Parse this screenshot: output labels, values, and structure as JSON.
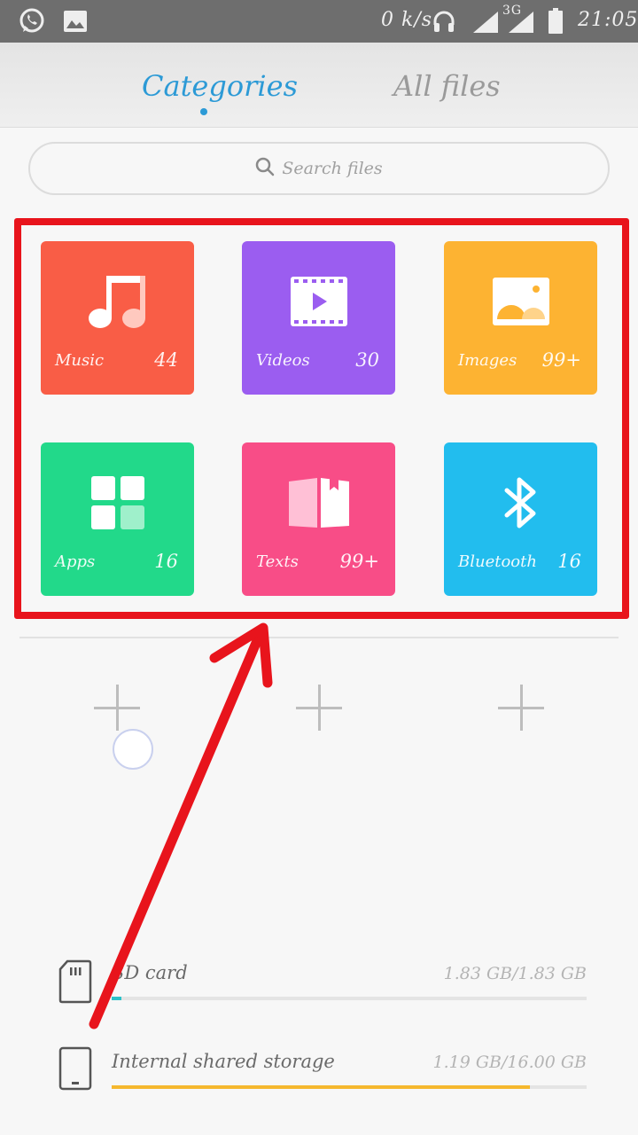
{
  "status_bar": {
    "speed": "0 k/s",
    "network": "3G",
    "time": "21:05",
    "icons": [
      "whatsapp-icon",
      "gallery-icon",
      "headphones-icon",
      "signal-icon",
      "battery-icon"
    ]
  },
  "tabs": [
    {
      "label": "Categories",
      "active": true
    },
    {
      "label": "All files",
      "active": false
    }
  ],
  "search": {
    "placeholder": "Search files"
  },
  "categories": [
    {
      "label": "Music",
      "count": "44",
      "color": "#f95d46",
      "icon": "music-note-icon"
    },
    {
      "label": "Videos",
      "count": "30",
      "color": "#9b5df0",
      "icon": "video-icon"
    },
    {
      "label": "Images",
      "count": "99+",
      "color": "#fdb332",
      "icon": "image-icon"
    },
    {
      "label": "Apps",
      "count": "16",
      "color": "#22d98a",
      "icon": "apps-grid-icon"
    },
    {
      "label": "Texts",
      "count": "99+",
      "color": "#f84d87",
      "icon": "book-icon"
    },
    {
      "label": "Bluetooth",
      "count": "16",
      "color": "#22bdee",
      "icon": "bluetooth-icon"
    }
  ],
  "shortcut_slots": 3,
  "storage": [
    {
      "name": "SD card",
      "size": "1.83 GB/1.83 GB",
      "fill": 0.02,
      "color": "#2bc1c8",
      "icon": "sd-card-icon"
    },
    {
      "name": "Internal shared storage",
      "size": "1.19 GB/16.00 GB",
      "fill": 0.88,
      "color": "#f5b82e",
      "icon": "phone-icon"
    }
  ],
  "colors": {
    "accent": "#2c9ad6",
    "highlight": "#e8141c"
  }
}
